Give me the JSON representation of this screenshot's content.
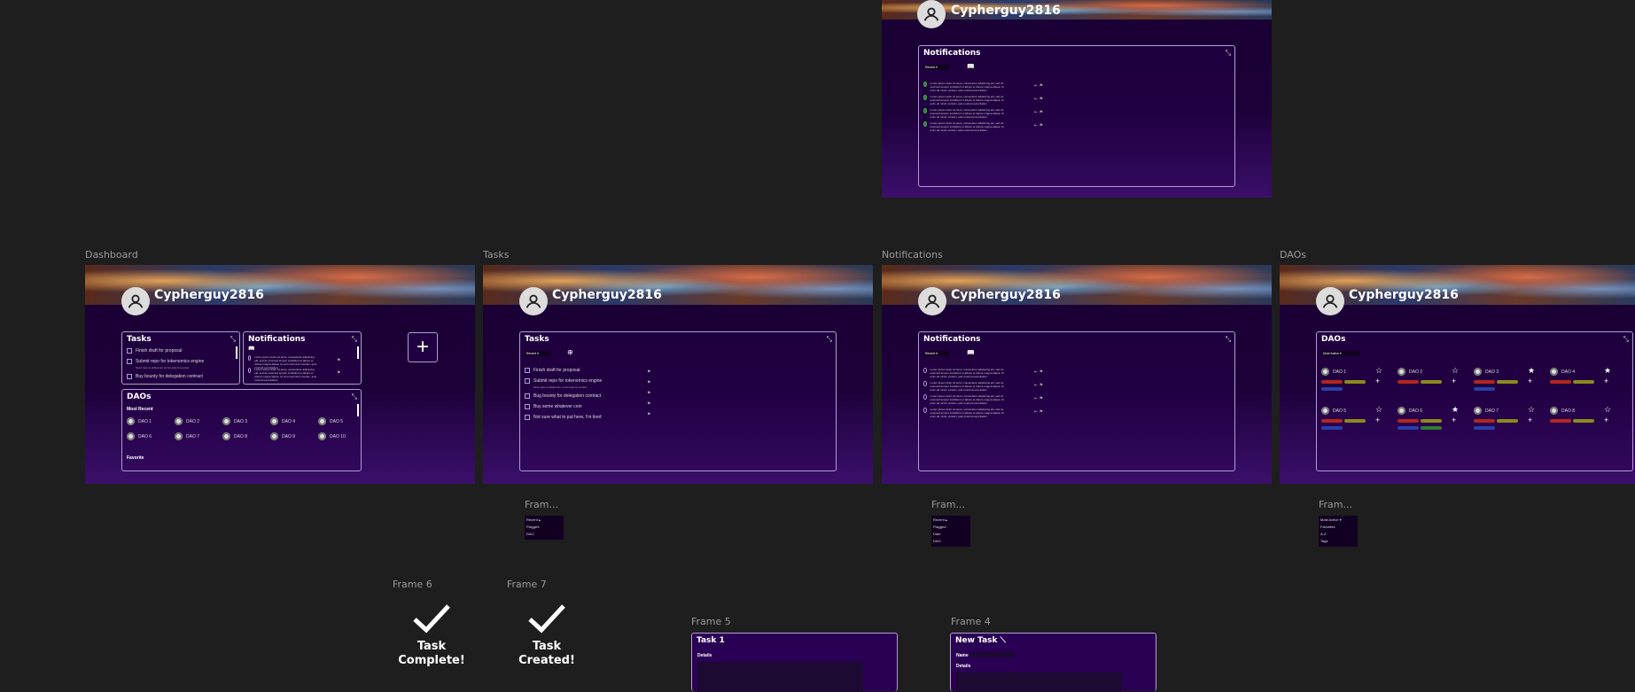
{
  "username": "Cypherguy2816",
  "frame_labels": {
    "dashboard": "Dashboard",
    "tasks": "Tasks",
    "notifications": "Notifications",
    "daos": "DAOs",
    "frame_a": "Fram...",
    "frame_b": "Fram...",
    "frame_c": "Fram...",
    "frame6": "Frame 6",
    "frame7": "Frame 7",
    "frame5": "Frame 5",
    "frame4": "Frame 4"
  },
  "panels": {
    "tasks": "Tasks",
    "notifications": "Notifications",
    "daos": "DAOs",
    "task1": "Task 1",
    "new_task": "New Task"
  },
  "dropdowns": {
    "recent": "Recent",
    "most_active": "Most Active",
    "tasks_menu": [
      "Recent",
      "Flagged",
      "DAO"
    ],
    "notif_menu": [
      "Recent",
      "Flagged",
      "Date",
      "DAO"
    ],
    "dao_menu": [
      "Most Active",
      "Favorites",
      "A-Z",
      "Tags"
    ]
  },
  "tasks": [
    {
      "label": "Finish draft for proposal",
      "sub": ""
    },
    {
      "label": "Submit repo for tokenomics engine",
      "sub": "Send repo to Ethereum community for review"
    },
    {
      "label": "Bug bounty for delegation contract",
      "sub": ""
    },
    {
      "label": "Buy some whatever coin",
      "sub": ""
    },
    {
      "label": "Not sure what to put here, I'm tired",
      "sub": ""
    }
  ],
  "dashboard_tasks": [
    {
      "label": "Finish draft for proposal",
      "sub": ""
    },
    {
      "label": "Submit repo for tokenomics engine",
      "sub": "Send repo to Ethereum community for review"
    },
    {
      "label": "Buy bounty for delegation contract",
      "sub": ""
    }
  ],
  "notification_text": "Lorem ipsum dolor sit amet, consectetur adipiscing elit, sed do eiusmod tempor incididunt ut labore et dolore magna aliqua. Ut enim ad minim veniam, quis nostrud exercitation.",
  "daos_small": {
    "most_recent": "Most Recent",
    "favorite": "Favorite",
    "row1": [
      "DAO 1",
      "DAO 2",
      "DAO 3",
      "DAO 4",
      "DAO 5"
    ],
    "row2": [
      "DAO 6",
      "DAO 7",
      "DAO 8",
      "DAO 9",
      "DAO 10"
    ]
  },
  "daos_big": {
    "row1": [
      "DAO 1",
      "DAO 2",
      "DAO 3",
      "DAO 4"
    ],
    "row2": [
      "DAO 5",
      "DAO 6",
      "DAO 7",
      "DAO 8"
    ]
  },
  "task_complete": [
    "Task",
    "Complete!"
  ],
  "task_created": [
    "Task",
    "Created!"
  ],
  "task1": {
    "details": "Details"
  },
  "new_task": {
    "name": "Name",
    "details": "Details"
  },
  "plus": "+",
  "colors": {
    "canvas": "#1e1e1e",
    "panel_border": "#b59ad8",
    "green": "#4caf50",
    "tag_red": "#b3261e",
    "tag_olive": "#8a8a1e",
    "tag_blue": "#2a3fa8"
  }
}
